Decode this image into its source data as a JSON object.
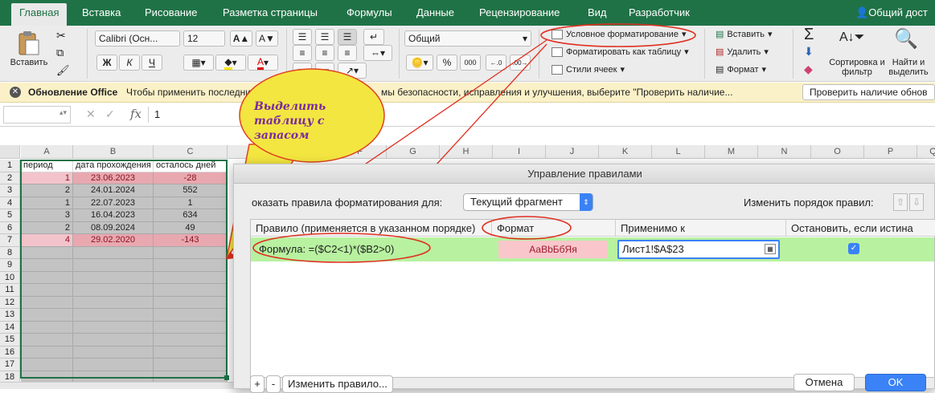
{
  "tabs": [
    "Главная",
    "Вставка",
    "Рисование",
    "Разметка страницы",
    "Формулы",
    "Данные",
    "Рецензирование",
    "Вид",
    "Разработчик"
  ],
  "share_label": "Общий дост",
  "ribbon": {
    "paste_label": "Вставить",
    "font_name": "Calibri (Осн...",
    "font_size": "12",
    "bold": "Ж",
    "italic": "К",
    "underline": "Ч",
    "number_format": "Общий",
    "percent": "%",
    "thousands": "000",
    "conditional_formatting": "Условное форматирование",
    "format_as_table": "Форматировать как таблицу",
    "cell_styles": "Стили ячеек",
    "insert": "Вставить",
    "delete": "Удалить",
    "format": "Формат",
    "sort_filter": "Сортировка и фильтр",
    "find_select": "Найти и выделить",
    "sigma": "Σ"
  },
  "update_bar": {
    "title": "Обновление Office",
    "message_left": "Чтобы применить последни",
    "message_right": "мы безопасности, исправления и улучшения, выберите \"Проверить наличие...",
    "button": "Проверить наличие обнов"
  },
  "formula_bar": {
    "fx": "fx",
    "value": "1",
    "cancel": "✕",
    "confirm": "✓"
  },
  "sheet": {
    "columns": [
      "A",
      "B",
      "C",
      "D",
      "E",
      "F",
      "G",
      "H",
      "I",
      "J",
      "K",
      "L",
      "M",
      "N",
      "O",
      "P",
      "Q"
    ],
    "rows": [
      "1",
      "2",
      "3",
      "4",
      "5",
      "6",
      "7",
      "8",
      "9",
      "10",
      "11",
      "12",
      "13",
      "14",
      "15",
      "16",
      "17",
      "18"
    ],
    "headers": [
      "период",
      "дата прохождения",
      "осталось дней"
    ],
    "data": [
      [
        "1",
        "23.06.2023",
        "-28"
      ],
      [
        "2",
        "24.01.2024",
        "552"
      ],
      [
        "1",
        "22.07.2023",
        "1"
      ],
      [
        "3",
        "16.04.2023",
        "634"
      ],
      [
        "2",
        "08.09.2024",
        "49"
      ],
      [
        "4",
        "29.02.2020",
        "-143"
      ]
    ]
  },
  "callout": "Выделить таблицу с запасом",
  "dialog": {
    "title": "Управление правилами",
    "show_rules_label": "оказать правила форматирования для:",
    "show_rules_value": "Текущий фрагмент",
    "reorder_label": "Изменить порядок правил:",
    "col_rule": "Правило (применяется в указанном порядке)",
    "col_format": "Формат",
    "col_applies": "Применимо к",
    "col_stop": "Остановить, если истина",
    "rule_text": "Формула: =($C2<1)*($B2>0)",
    "format_preview": "АаВbБбЯя",
    "applies_to": "Лист1!$A$23",
    "stop_checked": "✓",
    "btn_add": "+",
    "btn_remove": "-",
    "btn_edit": "Изменить правило...",
    "btn_cancel": "Отмена",
    "btn_ok": "OK"
  }
}
